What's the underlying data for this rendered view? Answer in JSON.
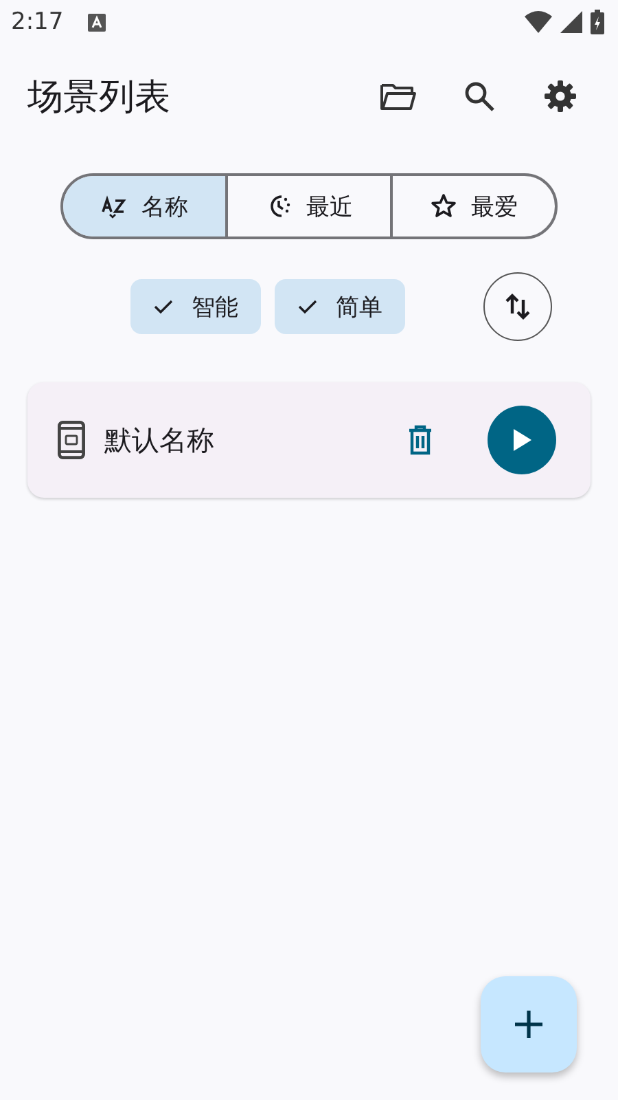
{
  "status_bar": {
    "time": "2:17"
  },
  "app_bar": {
    "title": "场景列表"
  },
  "sort_tabs": [
    {
      "kind": "az",
      "label": "名称",
      "selected": true
    },
    {
      "kind": "recent",
      "label": "最近",
      "selected": false
    },
    {
      "kind": "star",
      "label": "最爱",
      "selected": false
    }
  ],
  "filter_chips": [
    {
      "label": "智能",
      "checked": true
    },
    {
      "label": "简单",
      "checked": true
    }
  ],
  "scenes": [
    {
      "name": "默认名称"
    }
  ]
}
